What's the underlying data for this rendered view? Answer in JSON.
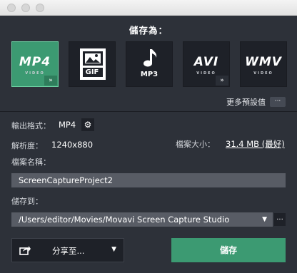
{
  "window": {
    "controls": [
      "close",
      "minimize",
      "zoom"
    ]
  },
  "heading": "儲存為：",
  "formats": [
    {
      "label": "MP4",
      "sub": "VIDEO",
      "selected": true,
      "has_options": true
    },
    {
      "label": "GIF",
      "icon": "image-icon",
      "selected": false,
      "has_options": false
    },
    {
      "label": "MP3",
      "icon": "music-note-icon",
      "selected": false,
      "has_options": false
    },
    {
      "label": "AVI",
      "sub": "VIDEO",
      "selected": false,
      "has_options": true
    },
    {
      "label": "WMV",
      "sub": "VIDEO",
      "selected": false,
      "has_options": false
    }
  ],
  "more_presets": {
    "label": "更多預設值",
    "button": "···"
  },
  "output_format": {
    "label": "輸出格式：",
    "value": "MP4"
  },
  "resolution": {
    "label": "解析度：",
    "value": "1240x880"
  },
  "file_size": {
    "label": "檔案大小：",
    "value": "31.4 MB (最好)"
  },
  "file_name": {
    "label": "檔案名稱：",
    "value": "ScreenCaptureProject2"
  },
  "save_to": {
    "label": "儲存到：",
    "value": "/Users/editor/Movies/Movavi Screen Capture Studio",
    "browse": "..."
  },
  "share": {
    "label": "分享至..."
  },
  "save_button": "儲存",
  "colors": {
    "panel": "#2d3139",
    "accent": "#3c9a72",
    "field": "#585c65"
  }
}
